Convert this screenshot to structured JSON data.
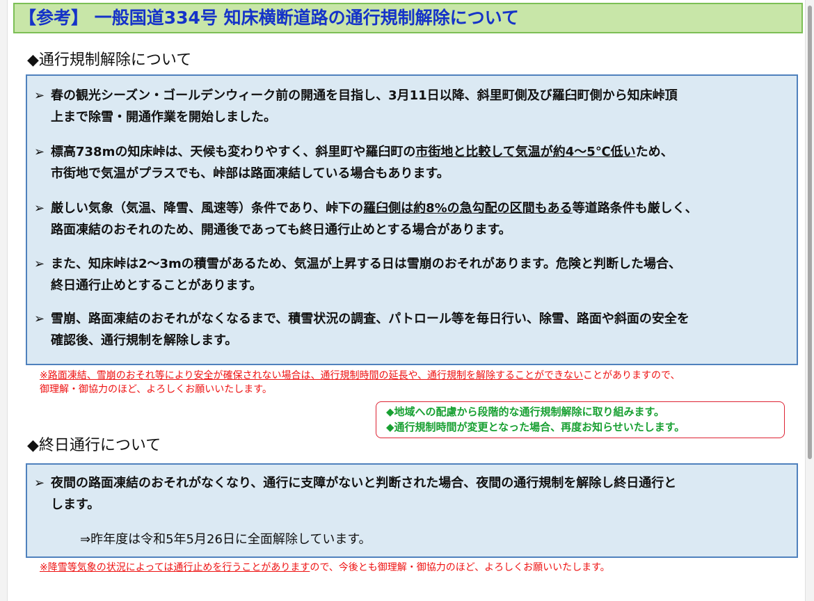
{
  "title": "【参考】 一般国道334号 知床横断道路の通行規制解除について",
  "section1": {
    "heading": "◆通行規制解除について",
    "items": [
      {
        "line1": "春の観光シーズン・ゴールデンウィーク前の開通を目指し、3月11日以降、斜里町側及び羅臼町側から知床峠頂",
        "line2": "上まで除雪・開通作業を開始しました。"
      },
      {
        "line1_a": "標高738mの知床峠は、天候も変わりやすく、斜里町や羅臼町の",
        "line1_u": "市街地と比較して気温が約4～5℃低い",
        "line1_b": "ため、",
        "line2": "市街地で気温がプラスでも、峠部は路面凍結している場合もあります。"
      },
      {
        "line1_a": "厳しい気象（気温、降雪、風速等）条件であり、峠下の",
        "line1_u": "羅臼側は約8%の急勾配の区間もある",
        "line1_b": "等道路条件も厳しく、",
        "line2": "路面凍結のおそれのため、開通後であっても終日通行止めとする場合があります。"
      },
      {
        "line1": "また、知床峠は2～3mの積雪があるため、気温が上昇する日は雪崩のおそれがあります。危険と判断した場合、",
        "line2": "終日通行止めとすることがあります。"
      },
      {
        "line1": "雪崩、路面凍結のおそれがなくなるまで、積雪状況の調査、パトロール等を毎日行い、除雪、路面や斜面の安全を",
        "line2": "確認後、通行規制を解除します。"
      }
    ],
    "note_u": "※路面凍結、雪崩のおそれ等により安全が確保されない場合は、通行規制時間の延長や、通行規制を解除することができない",
    "note_rest": "ことがありますので、",
    "note_line2": "御理解・御協力のほど、よろしくお願いいたします。"
  },
  "callout": {
    "line1": "◆地域への配慮から段階的な通行規制解除に取り組みます。",
    "line2": "◆通行規制時間が変更となった場合、再度お知らせいたします。"
  },
  "section2": {
    "heading": "◆終日通行について",
    "item_line1": "夜間の路面凍結のおそれがなくなり、通行に支障がないと判断された場合、夜間の通行規制を解除し終日通行と",
    "item_line2": "します。",
    "sub_note": "⇒昨年度は令和5年5月26日に全面解除しています。",
    "note_u": "※降雪等気象の状況によっては通行止めを行うことがあります",
    "note_rest": "ので、今後とも御理解・御協力のほど、よろしくお願いいたします。"
  },
  "bullet_glyph": "➢",
  "colors": {
    "title_bg": "#c8e6a8",
    "title_text": "#1533c8",
    "box_bg": "#dbe9f3",
    "box_border": "#4f81bd",
    "note_red": "#ee1111",
    "callout_green": "#18a032"
  }
}
